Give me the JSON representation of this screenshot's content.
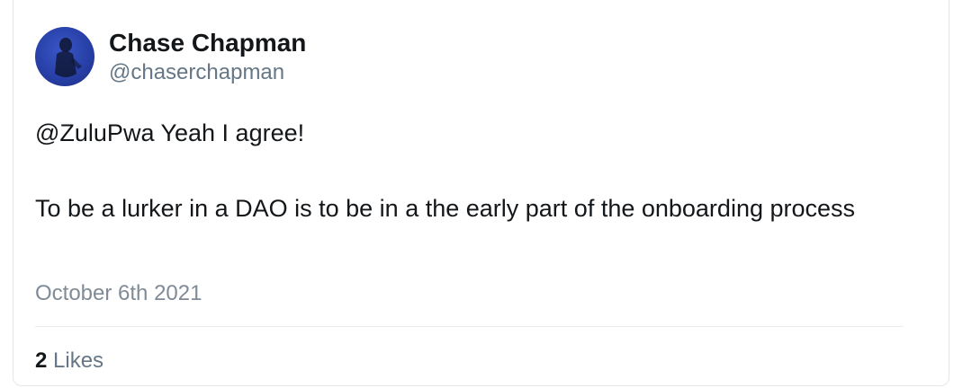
{
  "tweet": {
    "author": {
      "display_name": "Chase Chapman",
      "handle": "@chaserchapman",
      "avatar_icon": "user-avatar-icon"
    },
    "text_lines": [
      "@ZuluPwa Yeah I agree!",
      "To be a lurker in a DAO is to be in a the early part of the onboarding process"
    ],
    "timestamp": "October 6th 2021",
    "likes": {
      "count": "2",
      "label": "Likes"
    }
  },
  "colors": {
    "text_primary": "#14171a",
    "text_secondary": "#657786",
    "avatar_bg": "#2840a8"
  }
}
